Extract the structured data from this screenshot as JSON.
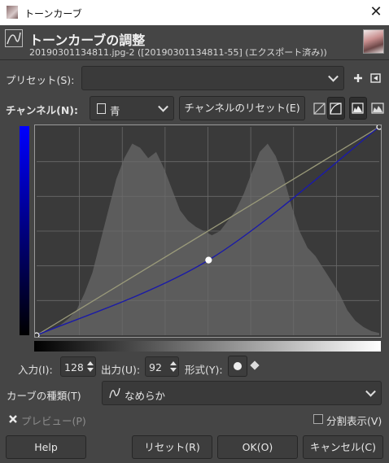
{
  "window": {
    "title": "トーンカーブ",
    "close_glyph": "✕"
  },
  "header": {
    "title": "トーンカーブの調整",
    "subtitle": "20190301134811.jpg-2 ([20190301134811-55] (エクスポート済み))"
  },
  "presets": {
    "label": "プリセット(S):",
    "value": ""
  },
  "channel": {
    "label": "チャンネル(N):",
    "value": "青",
    "reset_label": "チャンネルのリセット(E)"
  },
  "io": {
    "input_label": "入力(I):",
    "input_value": "128",
    "output_label": "出力(U):",
    "output_value": "92",
    "format_label": "形式(Y):"
  },
  "curve_type": {
    "label": "カーブの種類(T)",
    "value": "なめらか"
  },
  "preview": {
    "label": "プレビュー(P)",
    "checked": true
  },
  "split": {
    "label": "分割表示(V)",
    "checked": false
  },
  "buttons": {
    "help": "Help",
    "reset": "リセット(R)",
    "ok": "OK(O)",
    "cancel": "キャンセル(C)"
  },
  "colors": {
    "curve": "#1a1aa8",
    "diagonal": "#9a9a7a",
    "histogram": "#5c5c5c",
    "channel_bar_top": "#0000ff"
  },
  "curve_points": [
    {
      "in": 0,
      "out": 0
    },
    {
      "in": 128,
      "out": 92
    },
    {
      "in": 255,
      "out": 255
    }
  ]
}
